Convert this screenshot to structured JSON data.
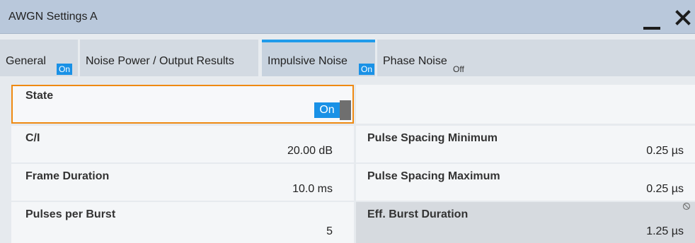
{
  "window": {
    "title": "AWGN Settings A"
  },
  "tabs": [
    {
      "label": "General",
      "state": "On"
    },
    {
      "label": "Noise Power / Output Results",
      "state": ""
    },
    {
      "label": "Impulsive Noise",
      "state": "On"
    },
    {
      "label": "Phase Noise",
      "state": "Off"
    }
  ],
  "active_tab": "Impulsive Noise",
  "fields": {
    "state": {
      "label": "State",
      "value": "On"
    },
    "ci": {
      "label": "C/I",
      "value": "20.00 dB"
    },
    "frame_duration": {
      "label": "Frame Duration",
      "value": "10.0 ms"
    },
    "pulses_per_burst": {
      "label": "Pulses per Burst",
      "value": "5"
    },
    "pulse_spacing_min": {
      "label": "Pulse Spacing Minimum",
      "value": "0.25 µs"
    },
    "pulse_spacing_max": {
      "label": "Pulse Spacing Maximum",
      "value": "0.25 µs"
    },
    "eff_burst_duration": {
      "label": "Eff. Burst Duration",
      "value": "1.25 µs"
    }
  },
  "colors": {
    "accent": "#1991e6",
    "focus": "#ef8a12",
    "titlebar": "#b9c8db"
  },
  "icons": {
    "minimize": "minimize-icon",
    "close": "close-icon",
    "readonly": "no-edit-icon"
  }
}
